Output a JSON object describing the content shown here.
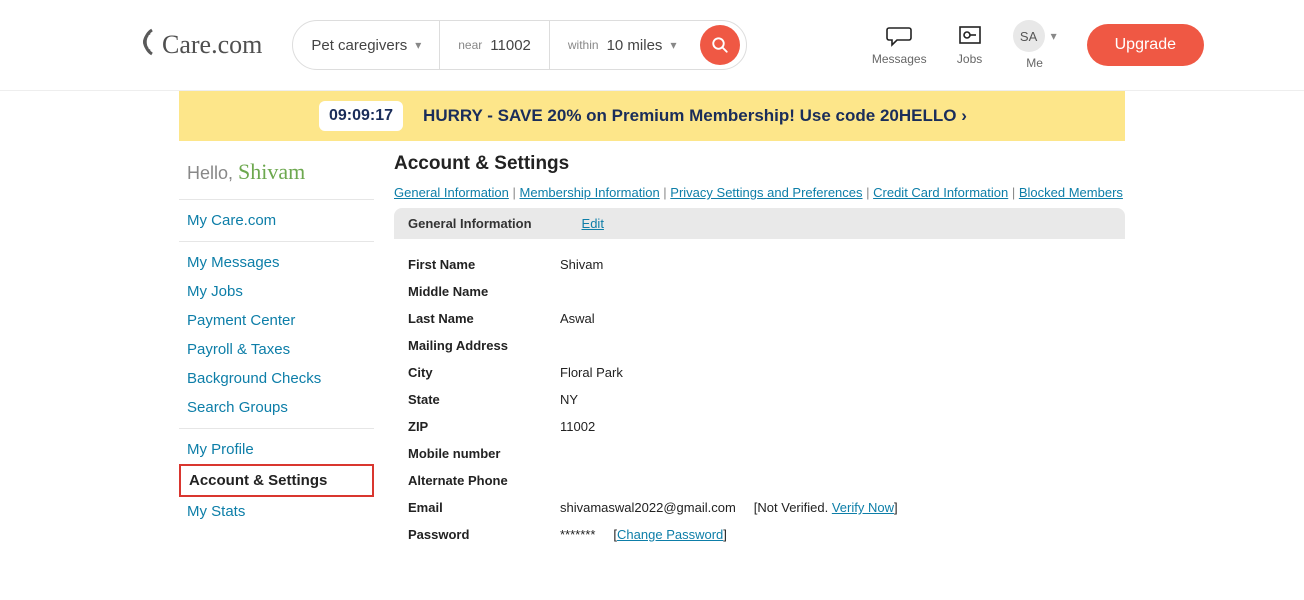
{
  "logo": {
    "text": "Care.com"
  },
  "search": {
    "category": "Pet caregivers",
    "near_label": "near",
    "near_value": "11002",
    "within_label": "within",
    "within_value": "10 miles"
  },
  "header_items": {
    "messages": "Messages",
    "jobs": "Jobs",
    "me_initials": "SA",
    "me_label": "Me",
    "upgrade": "Upgrade"
  },
  "promo": {
    "countdown": "09:09:17",
    "text": "HURRY - SAVE 20% on Premium Membership! Use code 20HELLO ›"
  },
  "greeting": {
    "prefix": "Hello, ",
    "name": "Shivam"
  },
  "sidebar": {
    "group1": [
      "My Care.com"
    ],
    "group2": [
      "My Messages",
      "My Jobs",
      "Payment Center",
      "Payroll & Taxes",
      "Background Checks",
      "Search Groups"
    ],
    "group3": [
      "My Profile",
      "Account & Settings",
      "My Stats"
    ],
    "active": "Account & Settings"
  },
  "panel": {
    "title": "Account & Settings",
    "tabs": [
      "General Information",
      "Membership Information",
      "Privacy Settings and Preferences",
      "Credit Card Information",
      "Blocked Members"
    ],
    "section_title": "General Information",
    "edit_label": "Edit"
  },
  "info": {
    "first_name_label": "First Name",
    "first_name": "Shivam",
    "middle_name_label": "Middle Name",
    "middle_name": "",
    "last_name_label": "Last Name",
    "last_name": "Aswal",
    "mailing_label": "Mailing Address",
    "mailing": "",
    "city_label": "City",
    "city": "Floral Park",
    "state_label": "State",
    "state": "NY",
    "zip_label": "ZIP",
    "zip": "11002",
    "mobile_label": "Mobile number",
    "mobile": "",
    "alt_phone_label": "Alternate Phone",
    "alt_phone": "",
    "email_label": "Email",
    "email": "shivamaswal2022@gmail.com",
    "email_status_prefix": "[Not Verified. ",
    "email_verify": "Verify Now",
    "email_status_suffix": "]",
    "password_label": "Password",
    "password_mask": "*******",
    "change_pw_prefix": "[",
    "change_pw": "Change Password",
    "change_pw_suffix": "]"
  }
}
